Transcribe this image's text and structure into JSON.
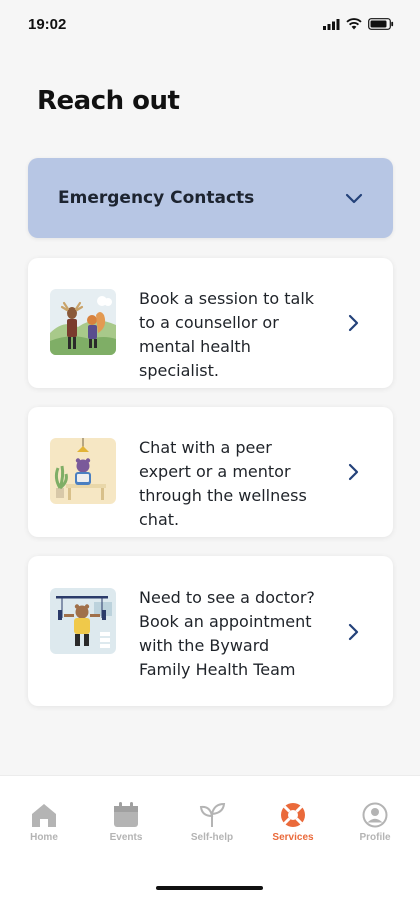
{
  "status_bar": {
    "time": "19:02"
  },
  "page": {
    "title": "Reach out"
  },
  "emergency": {
    "label": "Emergency Contacts"
  },
  "cards": [
    {
      "text": "Book a session to talk to a counsellor or mental health specialist."
    },
    {
      "text": "Chat with a peer expert or a mentor through the wellness chat."
    },
    {
      "text": "Need to see a doctor? Book an appointment with the Byward Family Health Team"
    }
  ],
  "nav": {
    "items": [
      {
        "label": "Home",
        "icon": "home-icon"
      },
      {
        "label": "Events",
        "icon": "calendar-icon"
      },
      {
        "label": "Self-help",
        "icon": "sprout-icon"
      },
      {
        "label": "Services",
        "icon": "lifebuoy-icon"
      },
      {
        "label": "Profile",
        "icon": "profile-icon"
      }
    ],
    "active": "Services"
  },
  "colors": {
    "accent": "#ea6a3b",
    "accordion_bg": "#b7c6e4",
    "chevron": "#24427a",
    "inactive": "#b4b4b4"
  }
}
